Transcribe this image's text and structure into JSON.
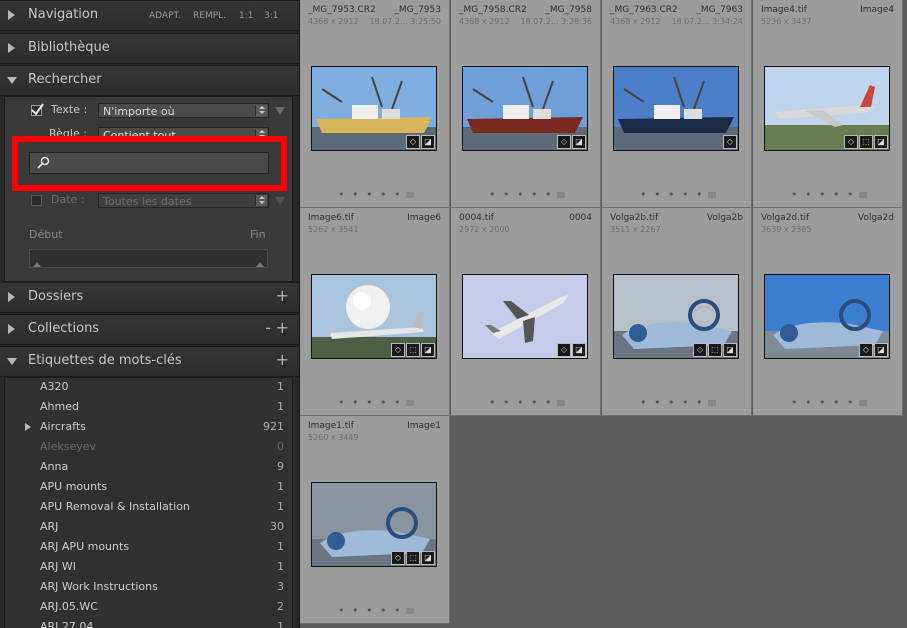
{
  "left_panel": {
    "navigation": {
      "title": "Navigation",
      "opts": [
        "ADAPT.",
        "REMPL.",
        "1:1",
        "3:1"
      ]
    },
    "bibliotheque": {
      "title": "Bibliothèque"
    },
    "rechercher": {
      "title": "Rechercher",
      "texte_label": "Texte :",
      "texte_value": "N'importe où",
      "regle_label": "Règle :",
      "regle_value": "Contient tout",
      "search_value": "",
      "date_label": "Date :",
      "date_value": "Toutes les dates",
      "debut_label": "Début",
      "fin_label": "Fin"
    },
    "dossiers": {
      "title": "Dossiers"
    },
    "collections": {
      "title": "Collections"
    },
    "etiquettes": {
      "title": "Etiquettes de mots-clés"
    },
    "keywords": [
      {
        "name": "A320",
        "count": "1"
      },
      {
        "name": "Ahmed",
        "count": "1"
      },
      {
        "name": "Aircrafts",
        "count": "921",
        "expandable": true
      },
      {
        "name": "Alekseyev",
        "count": "0",
        "disabled": true
      },
      {
        "name": "Anna",
        "count": "9"
      },
      {
        "name": "APU mounts",
        "count": "1"
      },
      {
        "name": "APU Removal & Installation",
        "count": "1"
      },
      {
        "name": "ARJ",
        "count": "30"
      },
      {
        "name": "ARJ APU mounts",
        "count": "1"
      },
      {
        "name": "ARJ WI",
        "count": "1"
      },
      {
        "name": "ARJ Work Instructions",
        "count": "3"
      },
      {
        "name": "ARJ.05.WC",
        "count": "2"
      },
      {
        "name": "ARJ.27.04",
        "count": "1"
      }
    ]
  },
  "grid": {
    "cells": [
      {
        "filename": "_MG_7953.CR2",
        "short": "_MG_7953",
        "dims": "4368 x 2912",
        "date": "18.07.2... 3:25:50",
        "scene": "ship-yellow"
      },
      {
        "filename": "_MG_7958.CR2",
        "short": "_MG_7958",
        "dims": "4368 x 2912",
        "date": "18.07.2... 3:28:36",
        "scene": "ship-red"
      },
      {
        "filename": "_MG_7963.CR2",
        "short": "_MG_7963",
        "dims": "4368 x 2912",
        "date": "18.07.2... 3:34:24",
        "scene": "ship-navy"
      },
      {
        "filename": "Image4.tif",
        "short": "Image4",
        "dims": "5236 x 3437",
        "date": "",
        "scene": "jet-ground"
      },
      {
        "filename": "Image6.tif",
        "short": "Image6",
        "dims": "5262 x 3541",
        "date": "",
        "scene": "balloon-plane"
      },
      {
        "filename": "0004.tif",
        "short": "0004",
        "dims": "2972 x 2000",
        "date": "",
        "scene": "jet-sky"
      },
      {
        "filename": "Volga2b.tif",
        "short": "Volga2b",
        "dims": "3511 x 2267",
        "date": "",
        "scene": "hover"
      },
      {
        "filename": "Volga2d.tif",
        "short": "Volga2d",
        "dims": "3639 x 2385",
        "date": "",
        "scene": "hover-sky"
      },
      {
        "filename": "Image1.tif",
        "short": "Image1",
        "dims": "5260 x 3449",
        "date": "",
        "scene": "hover-dark"
      }
    ],
    "dots": "• • • • •"
  },
  "colors": {
    "highlight": "#ff0000",
    "panel_bg": "#282828",
    "grid_bg": "#5c5c5c",
    "cell_bg": "#9c9c9c"
  }
}
